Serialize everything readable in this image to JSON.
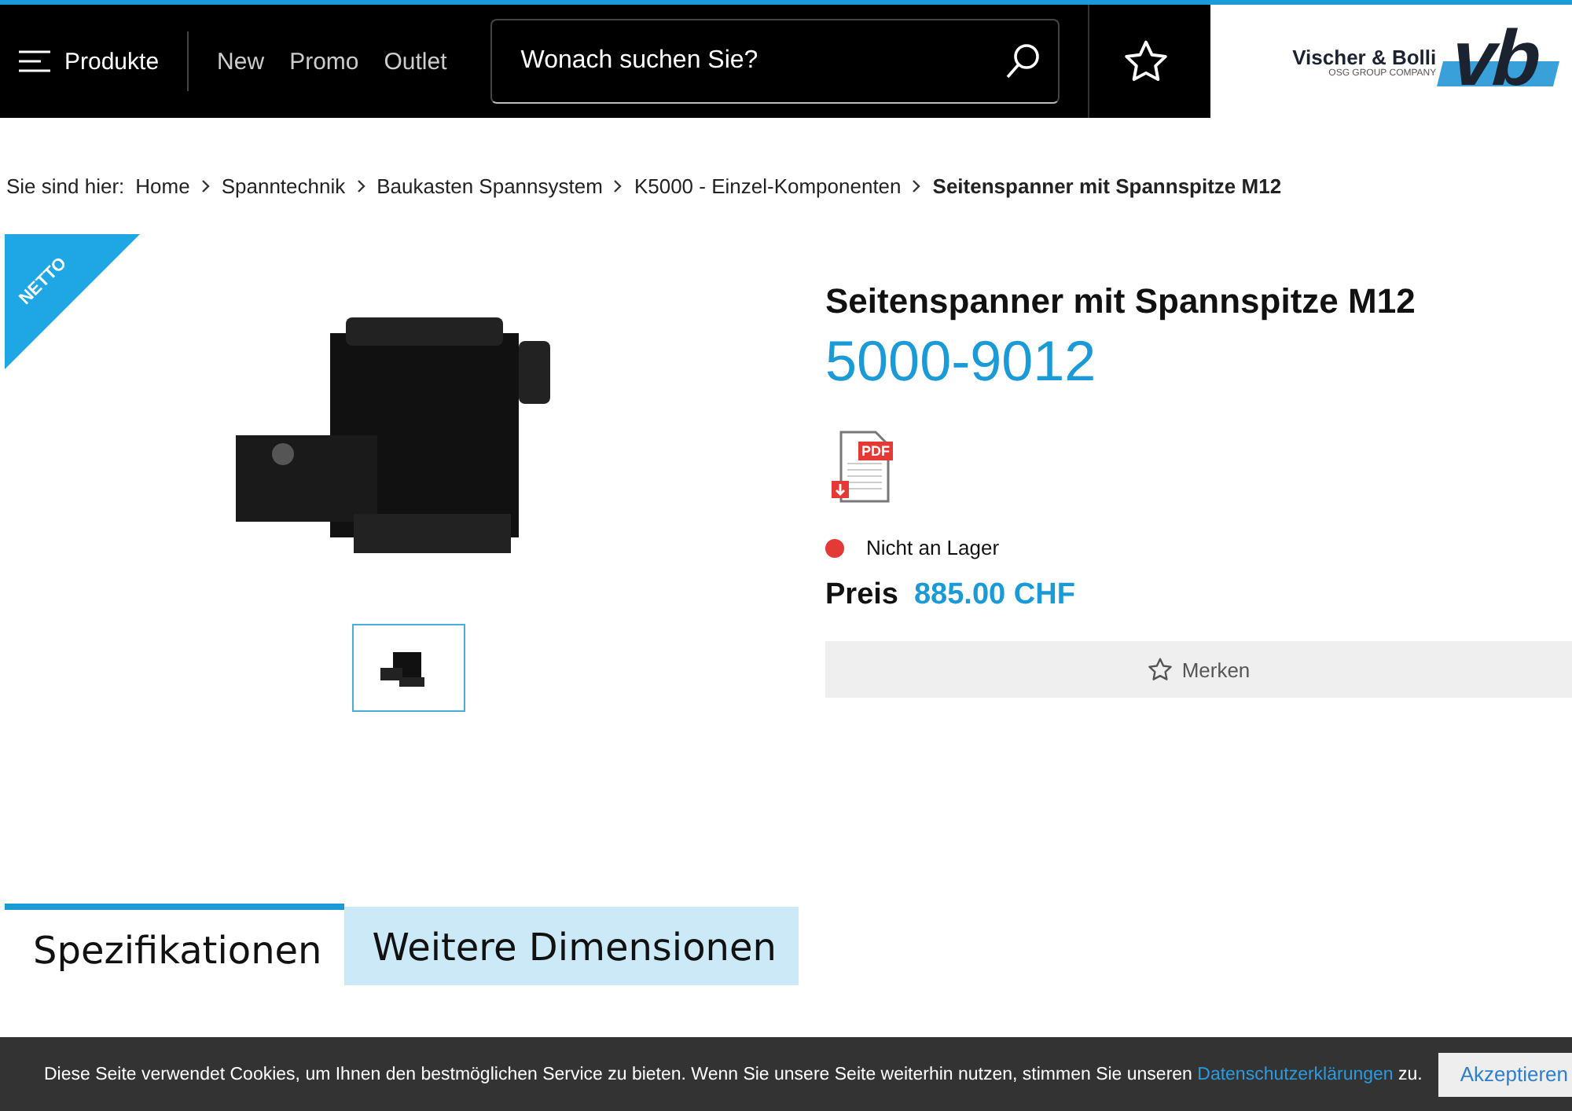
{
  "header": {
    "menu_label": "Produkte",
    "nav": [
      "New",
      "Promo",
      "Outlet"
    ],
    "search": {
      "placeholder": "Wonach suchen Sie?"
    },
    "logo": {
      "name": "Vischer & Bolli",
      "tagline": "OSG GROUP COMPANY",
      "mark": "vb"
    }
  },
  "breadcrumb": {
    "label": "Sie sind hier:",
    "items": [
      {
        "text": "Home",
        "current": false
      },
      {
        "text": "Spanntechnik",
        "current": false
      },
      {
        "text": "Baukasten Spannsystem",
        "current": false
      },
      {
        "text": "K5000 - Einzel-Komponenten",
        "current": false
      },
      {
        "text": "Seitenspanner mit Spannspitze M12",
        "current": true
      }
    ]
  },
  "product": {
    "badge": "NETTO",
    "thumbnails": [
      {
        "selected": true
      }
    ],
    "title": "Seitenspanner mit Spannspitze M12",
    "number": "5000-9012",
    "pdf_label": "PDF",
    "availability": {
      "text": "Nicht an Lager",
      "in_stock": false
    },
    "price_label": "Preis",
    "price": "885.00 CHF",
    "wishlist_button": "Merken"
  },
  "tabs": [
    {
      "label": "Spezifikationen",
      "selected": true
    },
    {
      "label": "Weitere Dimensionen",
      "selected": false
    }
  ],
  "cookie_bar": {
    "text_before": "Diese Seite verwendet Cookies, um Ihnen den bestmöglichen Service zu bieten. Wenn Sie unsere Seite weiterhin nutzen, stimmen Sie unseren ",
    "link": "Datenschutzerklärungen",
    "text_after": " zu.",
    "button": "Akzeptieren"
  }
}
